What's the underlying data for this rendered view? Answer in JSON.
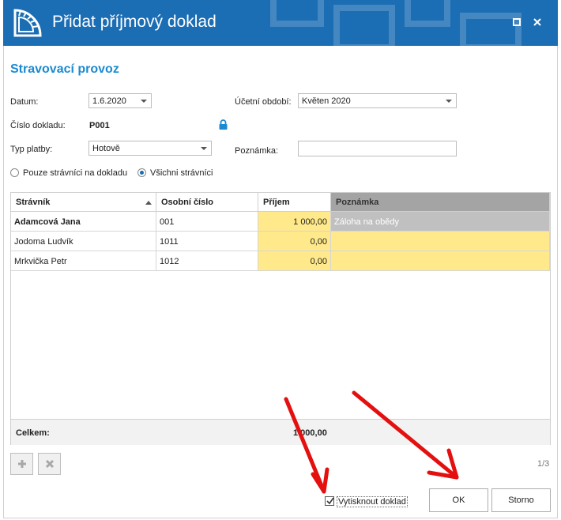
{
  "window": {
    "title": "Přidat příjmový doklad",
    "maximize_icon": "maximize-icon",
    "close_icon": "close-icon"
  },
  "section_title": "Stravovací provoz",
  "form": {
    "datum_label": "Datum:",
    "datum_value": "1.6.2020",
    "obdobi_label": "Účetní období:",
    "obdobi_value": "Květen 2020",
    "cislo_label": "Číslo dokladu:",
    "cislo_value": "P001",
    "typ_label": "Typ platby:",
    "typ_value": "Hotově",
    "poznamka_label": "Poznámka:",
    "poznamka_value": "",
    "radio_pouze": "Pouze strávníci na dokladu",
    "radio_vsichni": "Všichni strávníci",
    "selected_radio": "vsichni"
  },
  "grid": {
    "columns": [
      "Strávník",
      "Osobní číslo",
      "Příjem",
      "Poznámka"
    ],
    "rows": [
      {
        "stravnik": "Adamcová Jana",
        "cislo": "001",
        "prijem": "1 000,00",
        "poznamka": "Záloha na obědy"
      },
      {
        "stravnik": "Jodoma Ludvík",
        "cislo": "1011",
        "prijem": "0,00",
        "poznamka": ""
      },
      {
        "stravnik": "Mrkvička Petr",
        "cislo": "1012",
        "prijem": "0,00",
        "poznamka": ""
      }
    ],
    "total_label": "Celkem:",
    "total_value": "1 000,00"
  },
  "pager": "1/3",
  "print_checkbox": {
    "label": "Vytisknout doklad",
    "checked": true
  },
  "buttons": {
    "ok": "OK",
    "storno": "Storno"
  },
  "colors": {
    "titlebar": "#1b6db4",
    "accent_text": "#1b8ad0",
    "highlight": "#ffe98a",
    "selected_row": "#c0c0c0",
    "arrow": "#e41010"
  }
}
